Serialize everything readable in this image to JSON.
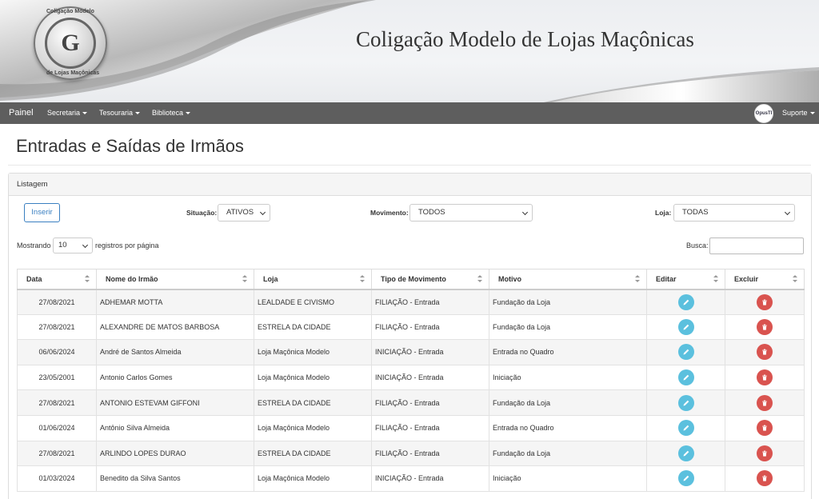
{
  "header": {
    "title": "Coligação Modelo de Lojas Maçônicas",
    "seal_letter": "G",
    "seal_text_top": "Coligação Modelo",
    "seal_text_bottom": "de Lojas Maçônicas"
  },
  "navbar": {
    "brand": "Painel",
    "menus": [
      "Secretaria",
      "Tesouraria",
      "Biblioteca"
    ],
    "op_logo_text": "OpusTI",
    "support": "Suporte"
  },
  "page": {
    "title": "Entradas e Saídas de Irmãos",
    "panel_title": "Listagem"
  },
  "toolbar": {
    "insert_label": "Inserir",
    "situacao_label": "Situação:",
    "situacao_value": "ATIVOS",
    "movimento_label": "Movimento:",
    "movimento_value": "TODOS",
    "loja_label": "Loja:",
    "loja_value": "TODAS",
    "showing_label": "Mostrando",
    "page_length": "10",
    "per_page_label": "registros por página",
    "search_label": "Busca:"
  },
  "table": {
    "columns": [
      "Data",
      "Nome do Irmão",
      "Loja",
      "Tipo de Movimento",
      "Motivo",
      "Editar",
      "Excluir"
    ],
    "rows": [
      [
        "27/08/2021",
        "ADHEMAR MOTTA",
        "LEALDADE E CIVISMO",
        "FILIAÇÃO - Entrada",
        "Fundação da Loja"
      ],
      [
        "27/08/2021",
        "ALEXANDRE DE MATOS BARBOSA",
        "ESTRELA DA CIDADE",
        "FILIAÇÃO - Entrada",
        "Fundação da Loja"
      ],
      [
        "06/06/2024",
        "André de Santos Almeida",
        "Loja Maçônica Modelo",
        "INICIAÇÃO - Entrada",
        "Entrada no Quadro"
      ],
      [
        "23/05/2001",
        "Antonio Carlos Gomes",
        "Loja Maçônica Modelo",
        "INICIAÇÃO - Entrada",
        "Iniciação"
      ],
      [
        "27/08/2021",
        "ANTONIO ESTEVAM GIFFONI",
        "ESTRELA DA CIDADE",
        "FILIAÇÃO - Entrada",
        "Fundação da Loja"
      ],
      [
        "01/06/2024",
        "Antônio Silva Almeida",
        "Loja Maçônica Modelo",
        "FILIAÇÃO - Entrada",
        "Entrada no Quadro"
      ],
      [
        "27/08/2021",
        "ARLINDO LOPES DURAO",
        "ESTRELA DA CIDADE",
        "FILIAÇÃO - Entrada",
        "Fundação da Loja"
      ],
      [
        "01/03/2024",
        "Benedito da Silva Santos",
        "Loja Maçônica Modelo",
        "INICIAÇÃO - Entrada",
        "Iniciação"
      ]
    ]
  },
  "colors": {
    "navbar": "#5e5e5e",
    "edit_button": "#5bc0de",
    "delete_button": "#d9534f",
    "insert_button": "#3a7fc1"
  },
  "icons": {
    "edit": "pencil-icon",
    "delete": "trash-icon"
  }
}
